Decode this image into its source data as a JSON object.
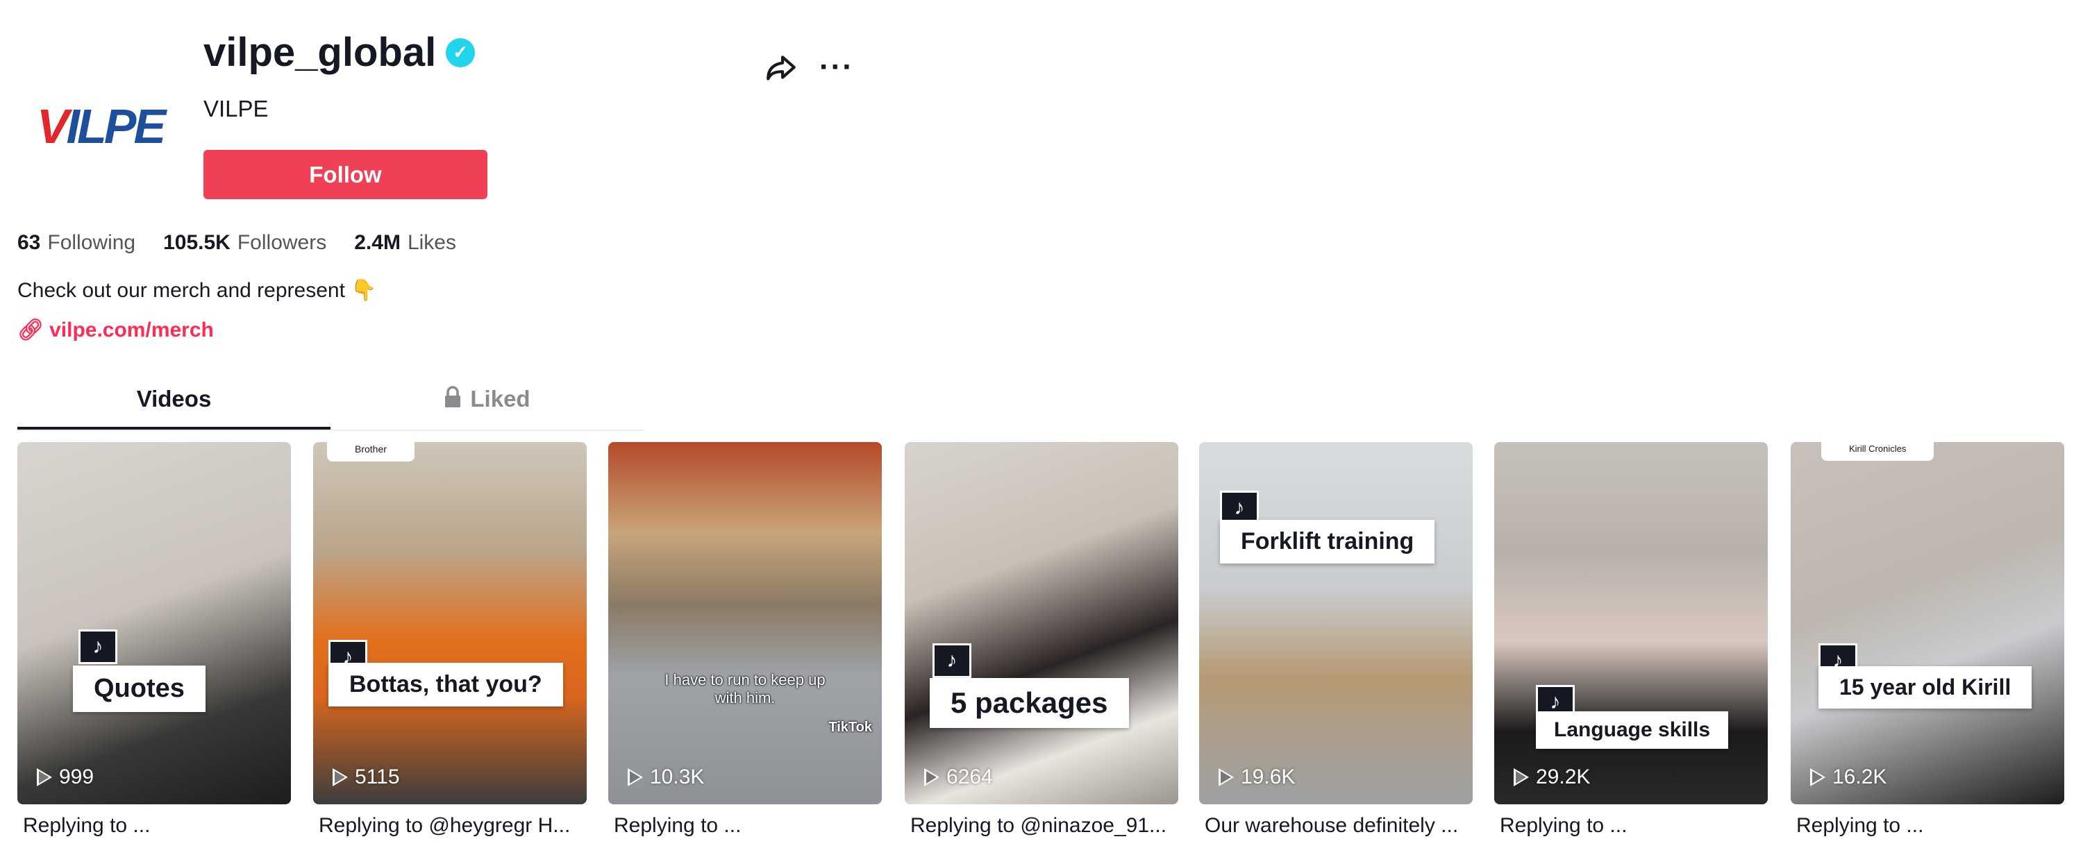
{
  "profile": {
    "avatar_logo": "VILPE",
    "username": "vilpe_global",
    "verified": true,
    "nickname": "VILPE",
    "follow_label": "Follow",
    "bio": "Check out our merch and represent 👇",
    "link": "vilpe.com/merch"
  },
  "stats": {
    "following": "63",
    "following_label": "Following",
    "followers": "105.5K",
    "followers_label": "Followers",
    "likes": "2.4M",
    "likes_label": "Likes"
  },
  "tabs": [
    {
      "label": "Videos",
      "active": true
    },
    {
      "label": "Liked",
      "locked": true
    }
  ],
  "colors": {
    "accent": "#fe2c55",
    "follow_button": "#ef4056",
    "verified": "#20d5ec"
  },
  "videos": [
    {
      "views": "999",
      "overlay": "Quotes",
      "caption": "Replying to ..."
    },
    {
      "views": "5115",
      "overlay": "Bottas, that you?",
      "note": "Brother",
      "caption": "Replying to @heygregr H..."
    },
    {
      "views": "10.3K",
      "overlay": "I have to run to keep up with him.",
      "watermark": "TikTok",
      "caption": "Replying to ..."
    },
    {
      "views": "6264",
      "overlay": "5 packages",
      "caption": "Replying to @ninazoe_91..."
    },
    {
      "views": "19.6K",
      "overlay": "Forklift training",
      "caption": "Our warehouse definitely ..."
    },
    {
      "views": "29.2K",
      "overlay": "Language skills",
      "caption": "Replying to ..."
    },
    {
      "views": "16.2K",
      "overlay": "15 year old Kirill",
      "note": "Kirill Cronicles",
      "caption": "Replying to ..."
    }
  ]
}
